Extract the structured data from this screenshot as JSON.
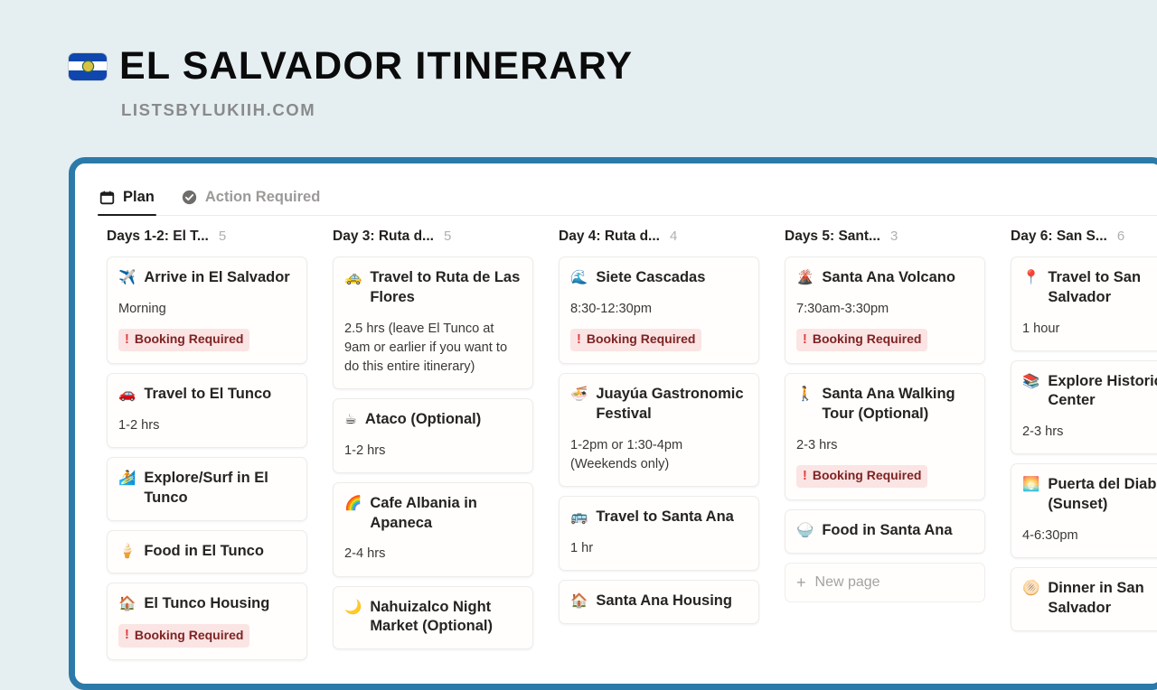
{
  "header": {
    "flag_icon": "el-salvador-flag",
    "title": "EL SALVADOR ITINERARY",
    "subtitle": "LISTSBYLUKIIH.COM"
  },
  "colors": {
    "page_background": "#e5eff2",
    "frame_border": "#2b7aa9",
    "badge_background": "#fbe4e4",
    "badge_text": "#7e2323",
    "badge_icon": "#e03e3e",
    "tab_active": "#1d1c1a",
    "tab_inactive": "#9b9a98"
  },
  "tabs": [
    {
      "label": "Plan",
      "icon": "calendar-icon",
      "active": true
    },
    {
      "label": "Action Required",
      "icon": "check-circle-icon",
      "active": false
    }
  ],
  "board": {
    "new_page_label": "New page",
    "badge_label": "Booking Required",
    "badge_bang": "!",
    "columns": [
      {
        "name": "Days 1-2: El T...",
        "count": "5",
        "cards": [
          {
            "emoji": "✈️",
            "icon": "airplane-icon",
            "title": "Arrive in El Salvador",
            "sub": "Morning",
            "badge": "Booking Required"
          },
          {
            "emoji": "🚗",
            "icon": "car-icon",
            "title": "Travel to El Tunco",
            "sub": "1-2 hrs",
            "badge": ""
          },
          {
            "emoji": "🏄",
            "icon": "surfer-icon",
            "title": "Explore/Surf in El Tunco",
            "sub": "",
            "badge": ""
          },
          {
            "emoji": "🍦",
            "icon": "ice-cream-icon",
            "title": "Food in El Tunco",
            "sub": "",
            "badge": ""
          },
          {
            "emoji": "🏠",
            "icon": "house-icon",
            "title": "El Tunco Housing",
            "sub": "",
            "badge": "Booking Required"
          }
        ]
      },
      {
        "name": "Day 3: Ruta d...",
        "count": "5",
        "cards": [
          {
            "emoji": "🚕",
            "icon": "taxi-icon",
            "title": "Travel to Ruta de Las Flores",
            "sub": "2.5 hrs (leave El Tunco at 9am or earlier if you want to do this entire itinerary)",
            "badge": ""
          },
          {
            "emoji": "☕",
            "icon": "coffee-icon",
            "title": "Ataco (Optional)",
            "sub": "1-2 hrs",
            "badge": ""
          },
          {
            "emoji": "🌈",
            "icon": "rainbow-icon",
            "title": "Cafe Albania in Apaneca",
            "sub": "2-4 hrs",
            "badge": ""
          },
          {
            "emoji": "🌙",
            "icon": "crescent-moon-icon",
            "title": "Nahuizalco Night Market (Optional)",
            "sub": "",
            "badge": ""
          }
        ]
      },
      {
        "name": "Day 4: Ruta d...",
        "count": "4",
        "cards": [
          {
            "emoji": "🌊",
            "icon": "wave-icon",
            "title": "Siete Cascadas",
            "sub": "8:30-12:30pm",
            "badge": "Booking Required"
          },
          {
            "emoji": "🍜",
            "icon": "food-icon",
            "title": "Juayúa Gastronomic Festival",
            "sub": "1-2pm or 1:30-4pm (Weekends only)",
            "badge": ""
          },
          {
            "emoji": "🚌",
            "icon": "bus-icon",
            "title": "Travel to Santa Ana",
            "sub": "1 hr",
            "badge": ""
          },
          {
            "emoji": "🏠",
            "icon": "house-icon",
            "title": "Santa Ana Housing",
            "sub": "",
            "badge": ""
          }
        ]
      },
      {
        "name": "Days 5: Sant...",
        "count": "3",
        "cards": [
          {
            "emoji": "🌋",
            "icon": "volcano-icon",
            "title": "Santa Ana Volcano",
            "sub": "7:30am-3:30pm",
            "badge": "Booking Required"
          },
          {
            "emoji": "🚶",
            "icon": "walking-person-icon",
            "title": "Santa Ana Walking Tour (Optional)",
            "sub": "2-3 hrs",
            "badge": "Booking Required"
          },
          {
            "emoji": "🍚",
            "icon": "rice-bowl-icon",
            "title": "Food in Santa Ana",
            "sub": "",
            "badge": ""
          }
        ],
        "has_new_page": true
      },
      {
        "name": "Day 6: San S...",
        "count": "6",
        "cards": [
          {
            "emoji": "📍",
            "icon": "map-pin-icon",
            "title": "Travel to San Salvador",
            "sub": "1 hour",
            "badge": ""
          },
          {
            "emoji": "📚",
            "icon": "books-icon",
            "title": "Explore Historic Center",
            "sub": "2-3 hrs",
            "badge": ""
          },
          {
            "emoji": "🌅",
            "icon": "sunset-icon",
            "title": "Puerta del Diablo (Sunset)",
            "sub": "4-6:30pm",
            "badge": ""
          },
          {
            "emoji": "🫓",
            "icon": "flatbread-icon",
            "title": "Dinner in San Salvador",
            "sub": "",
            "badge": ""
          }
        ]
      }
    ]
  }
}
